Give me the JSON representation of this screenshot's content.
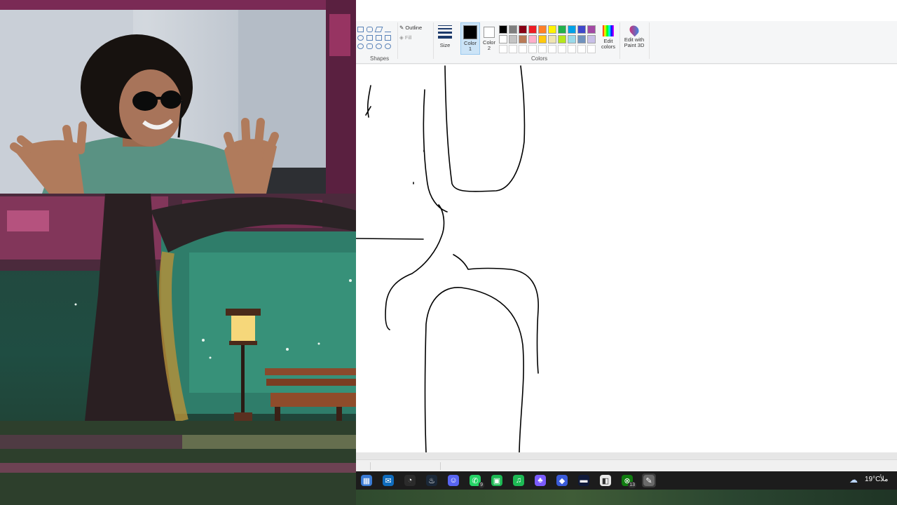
{
  "paint": {
    "shapes_group_label": "Shapes",
    "outline_label": "Outline",
    "fill_label": "Fill",
    "size_label": "Size",
    "color1_label": "Color\n1",
    "color2_label": "Color\n2",
    "colors_group_label": "Colors",
    "edit_colors_label": "Edit\ncolors",
    "edit_paint3d_label": "Edit with\nPaint 3D",
    "color1_value": "#000000",
    "color2_value": "#ffffff",
    "palette_row1": [
      "#000000",
      "#7f7f7f",
      "#880015",
      "#ed1c24",
      "#ff7f27",
      "#fff200",
      "#22b14c",
      "#00a2e8",
      "#3f48cc",
      "#a349a4"
    ],
    "palette_row2": [
      "#ffffff",
      "#c3c3c3",
      "#b97a57",
      "#ffaec9",
      "#ffc90e",
      "#efe4b0",
      "#b5e61d",
      "#99d9ea",
      "#7092be",
      "#c8bfe7"
    ]
  },
  "taskbar": {
    "apps": [
      {
        "name": "start-menu-icon",
        "glyph": "▦",
        "color": "#3a7bd5",
        "badge": ""
      },
      {
        "name": "outlook-icon",
        "glyph": "✉",
        "color": "#0f6cbd",
        "badge": ""
      },
      {
        "name": "clock-app-icon",
        "glyph": "◔",
        "color": "#2b2b2b",
        "badge": ""
      },
      {
        "name": "steam-icon",
        "glyph": "♨",
        "color": "#1b2838",
        "badge": ""
      },
      {
        "name": "discord-ptb-icon",
        "glyph": "☺",
        "color": "#5865f2",
        "badge": ""
      },
      {
        "name": "whatsapp-icon",
        "glyph": "✆",
        "color": "#25d366",
        "badge": "9"
      },
      {
        "name": "xbox-app-icon",
        "glyph": "▣",
        "color": "#1db954",
        "badge": ""
      },
      {
        "name": "spotify-icon",
        "glyph": "♫",
        "color": "#1db954",
        "badge": ""
      },
      {
        "name": "gamepad-app-icon",
        "glyph": "♣",
        "color": "#7b5cff",
        "badge": ""
      },
      {
        "name": "vpn-icon",
        "glyph": "◆",
        "color": "#3a5bd9",
        "badge": ""
      },
      {
        "name": "terminal-icon",
        "glyph": "▬",
        "color": "#101a3a",
        "badge": ""
      },
      {
        "name": "roblox-icon",
        "glyph": "◧",
        "color": "#e8e8e8",
        "badge": ""
      },
      {
        "name": "xbox-icon",
        "glyph": "⊗",
        "color": "#107c10",
        "badge": "13"
      },
      {
        "name": "paint-icon",
        "glyph": "✎",
        "color": "#6a6a6a",
        "badge": ""
      }
    ],
    "weather_temp": "19°C",
    "tray_text": "ملأ"
  }
}
